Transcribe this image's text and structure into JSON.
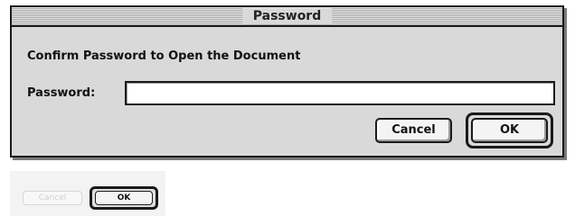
{
  "dialog": {
    "title": "Password",
    "heading": "Confirm Password to Open the Document",
    "password_label": "Password:",
    "password_value": "",
    "cancel_label": "Cancel",
    "ok_label": "OK"
  },
  "inset": {
    "cancel_label": "Cancel",
    "ok_label": "OK"
  },
  "colors": {
    "window_bg": "#d9d9d9",
    "border": "#1a1a1a"
  }
}
